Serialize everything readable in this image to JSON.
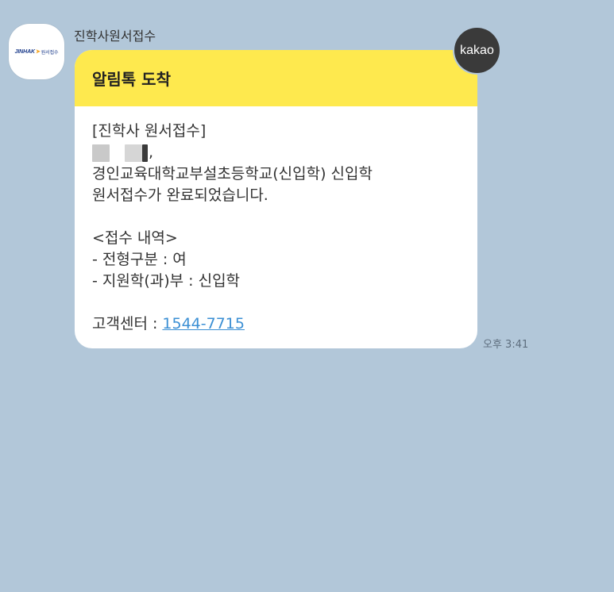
{
  "sender": {
    "name": "진학사원서접수",
    "avatar": {
      "brand": "JINHAK",
      "arrow": "➤",
      "subtitle": "원서접수",
      "icon": "jinhak-logo-icon"
    }
  },
  "message": {
    "header_title": "알림톡 도착",
    "lines": {
      "l1": "[진학사 원서접수]",
      "recipient_suffix": ",",
      "l3": "경인교육대학교부설초등학교(신입학) 신입학",
      "l4": "원서접수가 완료되었습니다.",
      "l6": "<접수 내역>",
      "l7": "- 전형구분 : 여",
      "l8": "- 지원학(과)부 : 신입학",
      "l10_label": "고객센터 : ",
      "l10_phone": "1544-7715"
    },
    "timestamp": "오후 3:41"
  },
  "badge": {
    "label": "kakao"
  },
  "colors": {
    "background": "#b2c7d9",
    "header": "#fee94e",
    "link": "#3b8fd4",
    "badge": "#3a3a3a"
  }
}
